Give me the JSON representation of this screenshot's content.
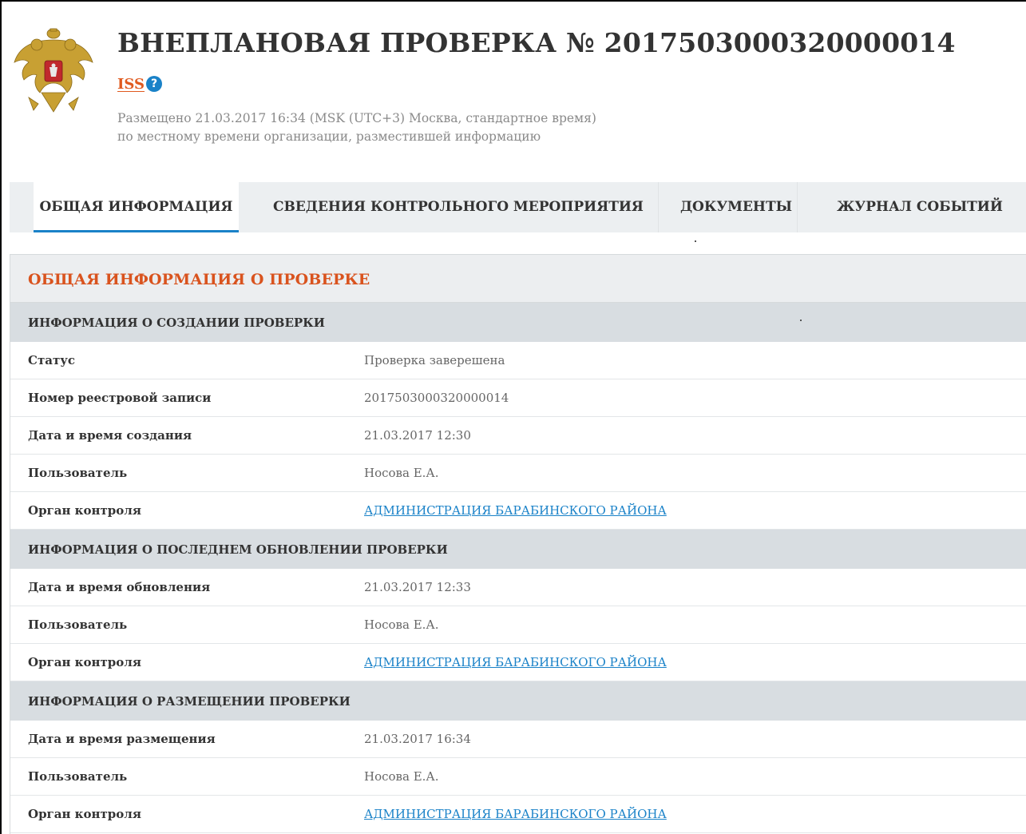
{
  "header": {
    "title": "ВНЕПЛАНОВАЯ ПРОВЕРКА № 2017503000320000014",
    "iss_link": "ISS",
    "help_icon": "question-circle-icon",
    "posted_line1": "Размещено 21.03.2017 16:34 (MSK (UTC+3) Москва, стандартное время)",
    "posted_line2": "по местному времени организации, разместившей информацию",
    "emblem": "russian-coat-of-arms"
  },
  "tabs": [
    {
      "label": "ОБЩАЯ ИНФОРМАЦИЯ",
      "active": true
    },
    {
      "label": "СВЕДЕНИЯ КОНТРОЛЬНОГО МЕРОПРИЯТИЯ",
      "active": false
    },
    {
      "label": "ДОКУМЕНТЫ",
      "active": false
    },
    {
      "label": "ЖУРНАЛ СОБЫТИЙ",
      "active": false
    }
  ],
  "panel": {
    "title": "ОБЩАЯ ИНФОРМАЦИЯ О ПРОВЕРКЕ",
    "sections": [
      {
        "title": "ИНФОРМАЦИЯ О СОЗДАНИИ ПРОВЕРКИ",
        "rows": [
          {
            "label": "Статус",
            "value": "Проверка заверешена"
          },
          {
            "label": "Номер реестровой записи",
            "value": "2017503000320000014"
          },
          {
            "label": "Дата и время создания",
            "value": "21.03.2017 12:30"
          },
          {
            "label": "Пользователь",
            "value": "Носова Е.А."
          },
          {
            "label": "Орган контроля",
            "value": "АДМИНИСТРАЦИЯ БАРАБИНСКОГО РАЙОНА"
          }
        ]
      },
      {
        "title": "ИНФОРМАЦИЯ О ПОСЛЕДНЕМ ОБНОВЛЕНИИ ПРОВЕРКИ",
        "rows": [
          {
            "label": "Дата и время обновления",
            "value": "21.03.2017 12:33"
          },
          {
            "label": "Пользователь",
            "value": "Носова Е.А."
          },
          {
            "label": "Орган контроля",
            "value": "АДМИНИСТРАЦИЯ БАРАБИНСКОГО РАЙОНА"
          }
        ]
      },
      {
        "title": "ИНФОРМАЦИЯ О РАЗМЕЩЕНИИ ПРОВЕРКИ",
        "rows": [
          {
            "label": "Дата и время размещения",
            "value": "21.03.2017 16:34"
          },
          {
            "label": "Пользователь",
            "value": "Носова Е.А."
          },
          {
            "label": "Орган контроля",
            "value": "АДМИНИСТРАЦИЯ БАРАБИНСКОГО РАЙОНА"
          }
        ]
      }
    ]
  },
  "colors": {
    "accent_orange": "#d9531e",
    "link_blue": "#1a82c8",
    "tab_bg": "#eceff1",
    "section_bg": "#d8dde1"
  }
}
